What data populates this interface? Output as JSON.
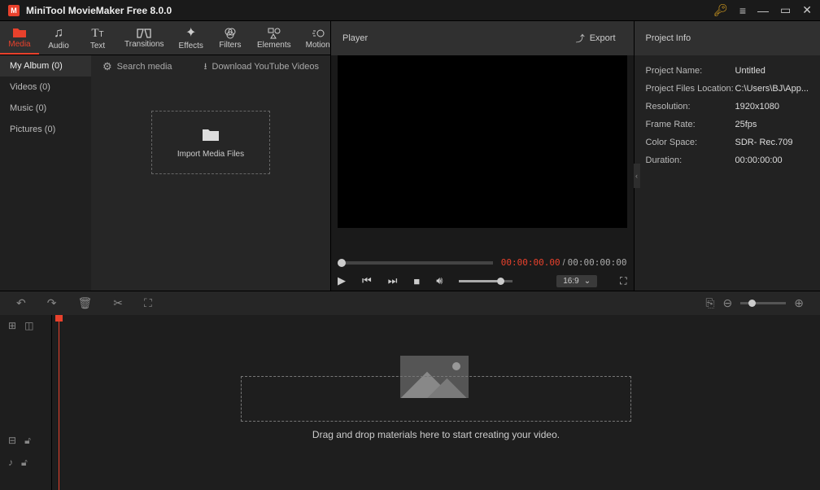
{
  "titlebar": {
    "title": "MiniTool MovieMaker Free 8.0.0"
  },
  "tabs": [
    {
      "label": "Media",
      "icon": "folder",
      "active": true
    },
    {
      "label": "Audio",
      "icon": "music"
    },
    {
      "label": "Text",
      "icon": "text"
    },
    {
      "label": "Transitions",
      "icon": "transitions"
    },
    {
      "label": "Effects",
      "icon": "effects"
    },
    {
      "label": "Filters",
      "icon": "filters"
    },
    {
      "label": "Elements",
      "icon": "elements"
    },
    {
      "label": "Motion",
      "icon": "motion"
    }
  ],
  "mediaSide": [
    {
      "label": "My Album (0)",
      "active": true
    },
    {
      "label": "Videos (0)"
    },
    {
      "label": "Music (0)"
    },
    {
      "label": "Pictures (0)"
    }
  ],
  "mediaToolbar": {
    "search": "Search media",
    "download": "Download YouTube Videos"
  },
  "importBox": "Import Media Files",
  "player": {
    "title": "Player",
    "export": "Export",
    "current": "00:00:00.00",
    "total": "00:00:00:00",
    "aspect": "16:9"
  },
  "projectInfo": {
    "title": "Project Info",
    "rows": [
      {
        "label": "Project Name:",
        "value": "Untitled"
      },
      {
        "label": "Project Files Location:",
        "value": "C:\\Users\\BJ\\App..."
      },
      {
        "label": "Resolution:",
        "value": "1920x1080"
      },
      {
        "label": "Frame Rate:",
        "value": "25fps"
      },
      {
        "label": "Color Space:",
        "value": "SDR- Rec.709"
      },
      {
        "label": "Duration:",
        "value": "00:00:00:00"
      }
    ]
  },
  "timeline": {
    "dropText": "Drag and drop materials here to start creating your video."
  }
}
